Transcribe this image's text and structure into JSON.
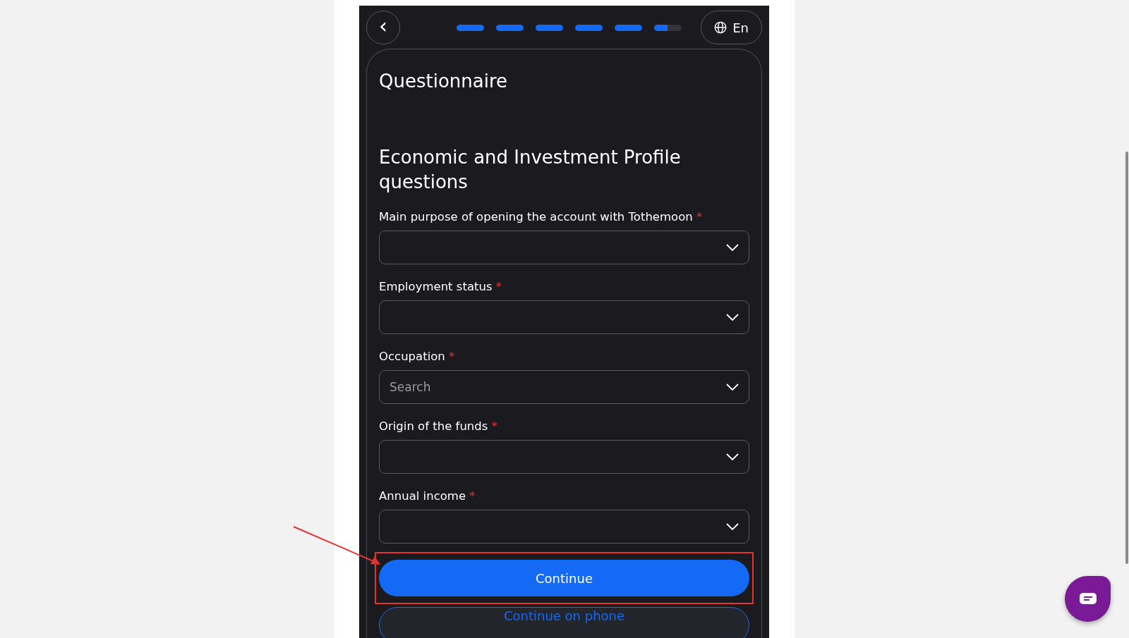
{
  "header": {
    "back_button": "‹",
    "language": "En",
    "progress": [
      {
        "level": 1
      },
      {
        "level": 1
      },
      {
        "level": 1
      },
      {
        "level": 1
      },
      {
        "level": 1
      },
      {
        "level": 0.5
      }
    ]
  },
  "card": {
    "title": "Questionnaire",
    "section_title": "Economic and Investment Profile questions",
    "fields": [
      {
        "label": "Main purpose of opening the account with Tothemoon",
        "required_mark": "*"
      },
      {
        "label": "Employment status",
        "required_mark": "*"
      },
      {
        "label": "Occupation",
        "required_mark": "*",
        "placeholder": "Search"
      },
      {
        "label": "Origin of the funds",
        "required_mark": "*"
      },
      {
        "label": "Annual income",
        "required_mark": "*"
      }
    ],
    "buttons": [
      {
        "label": "Continue",
        "kind": "primary",
        "highlighted": true
      },
      {
        "label": "Continue on phone",
        "kind": "secondary",
        "highlighted": false
      }
    ]
  }
}
